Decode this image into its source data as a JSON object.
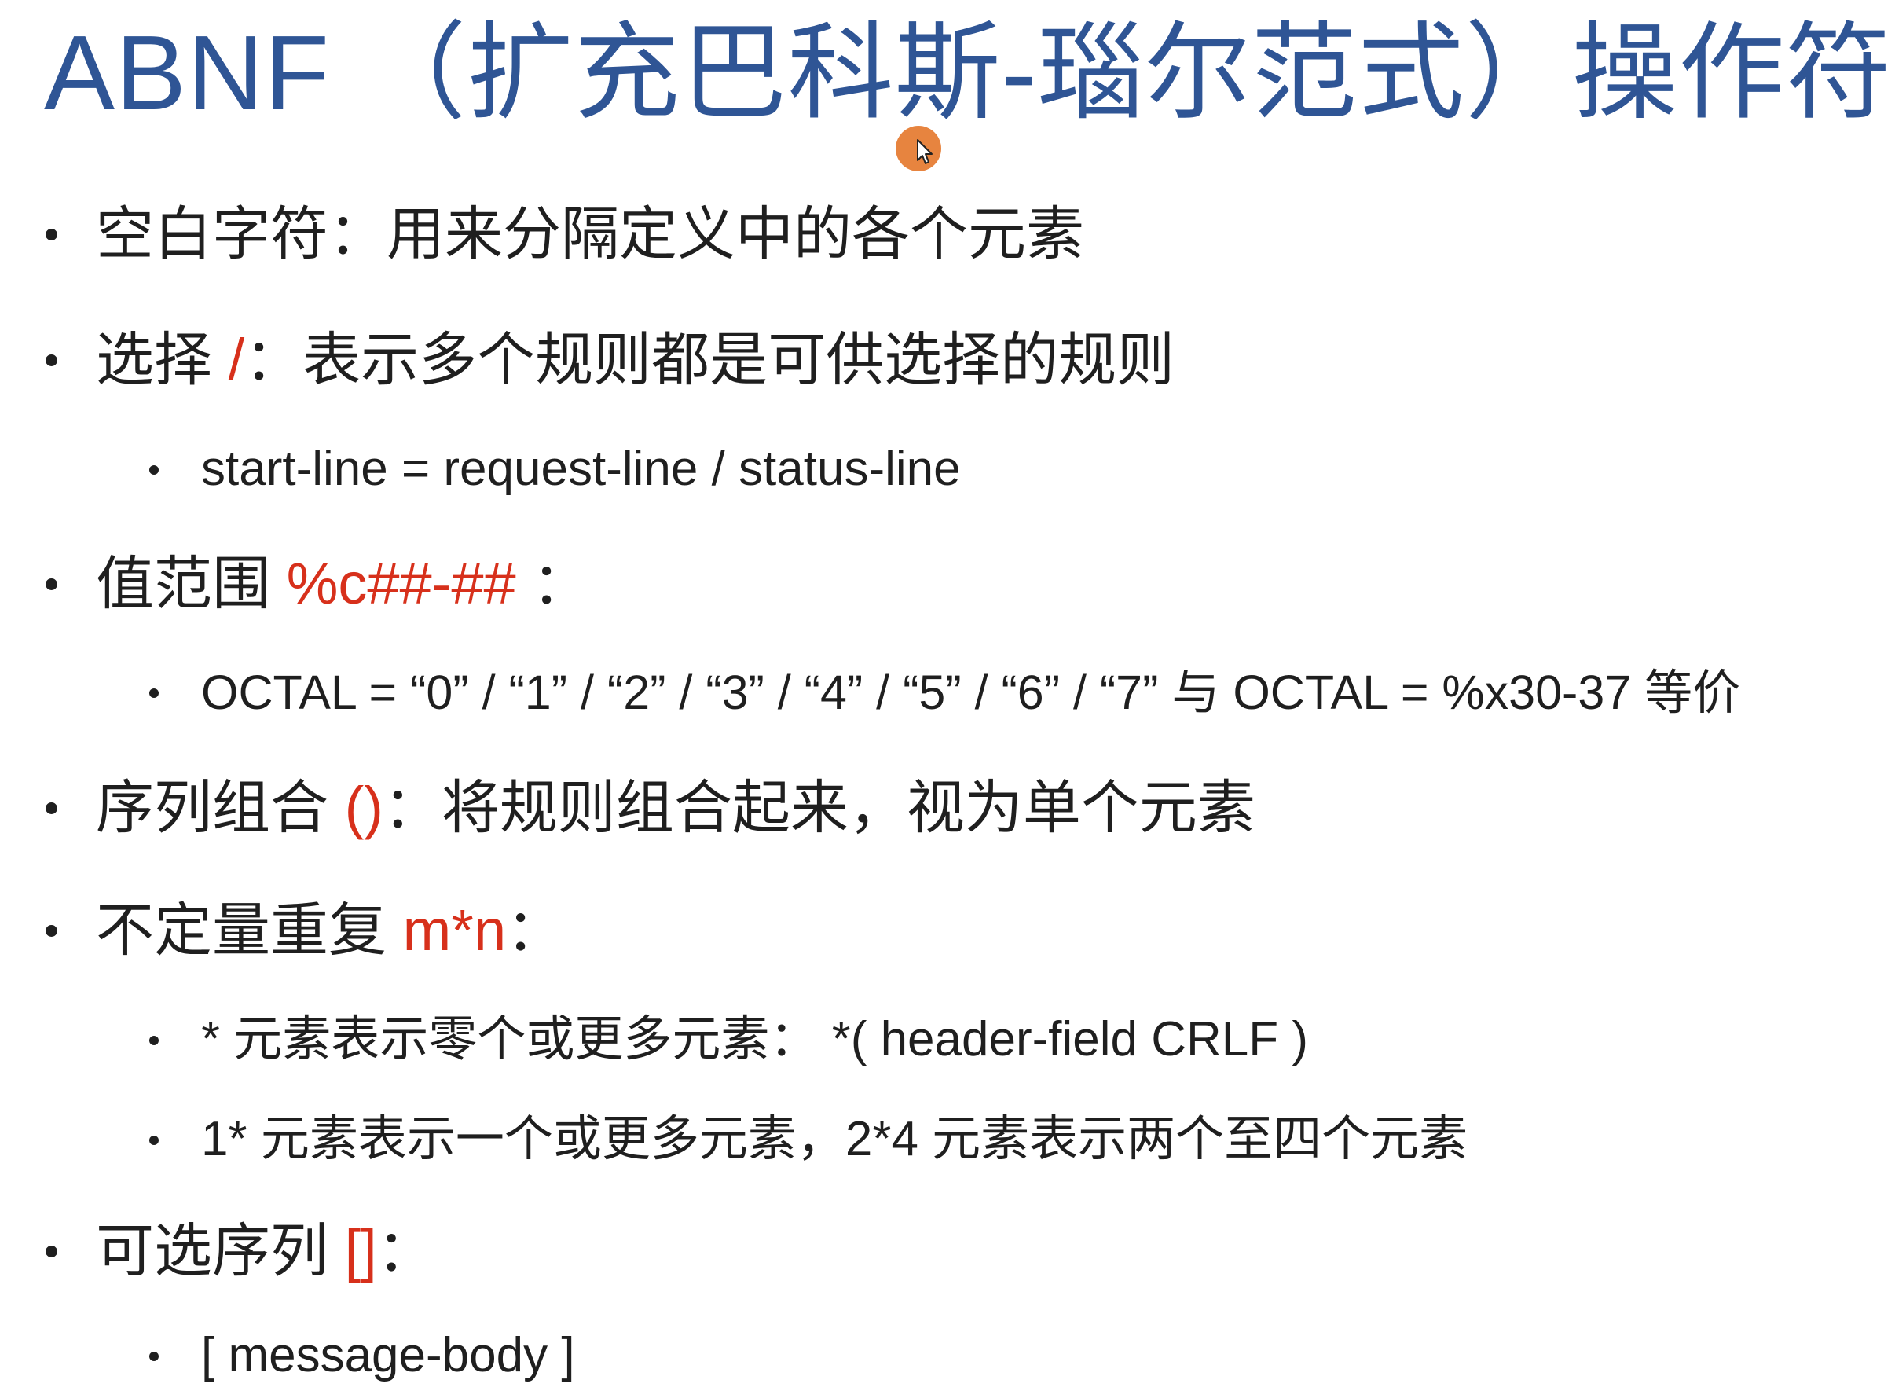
{
  "slide": {
    "title": "ABNF （扩充巴科斯-瑙尔范式）操作符",
    "items": [
      {
        "level": 1,
        "label": "空白字符",
        "operator": "",
        "after_operator": "：",
        "description": "用来分隔定义中的各个元素"
      },
      {
        "level": 1,
        "label": "选择 ",
        "operator": "/",
        "after_operator": "：",
        "description": "表示多个规则都是可供选择的规则"
      },
      {
        "level": 2,
        "text": "start-line = request-line / status-line"
      },
      {
        "level": 1,
        "label": "值范围 ",
        "operator": "%c##-##",
        "after_operator": " ：",
        "description": ""
      },
      {
        "level": 2,
        "text": "OCTAL = “0” / “1” / “2” / “3” / “4” / “5” / “6” / “7” 与 OCTAL = %x30-37 等价"
      },
      {
        "level": 1,
        "label": "序列组合 ",
        "operator": "()",
        "after_operator": "：",
        "description": "将规则组合起来，视为单个元素"
      },
      {
        "level": 1,
        "label": "不定量重复 ",
        "operator": "m*n",
        "after_operator": "：",
        "description": ""
      },
      {
        "level": 2,
        "text": "* 元素表示零个或更多元素：  *( header-field CRLF )"
      },
      {
        "level": 2,
        "text": "1* 元素表示一个或更多元素，2*4 元素表示两个至四个元素"
      },
      {
        "level": 1,
        "label": "可选序列 ",
        "operator": "[]",
        "after_operator": "：",
        "description": ""
      },
      {
        "level": 2,
        "text": "[ message-body ]"
      }
    ]
  },
  "colors": {
    "title": "#2f5595",
    "operator": "#d7301b",
    "text": "#1f1f1f",
    "cursor_highlight": "#e7843f"
  },
  "icons": {
    "cursor": "mouse-pointer-icon"
  }
}
